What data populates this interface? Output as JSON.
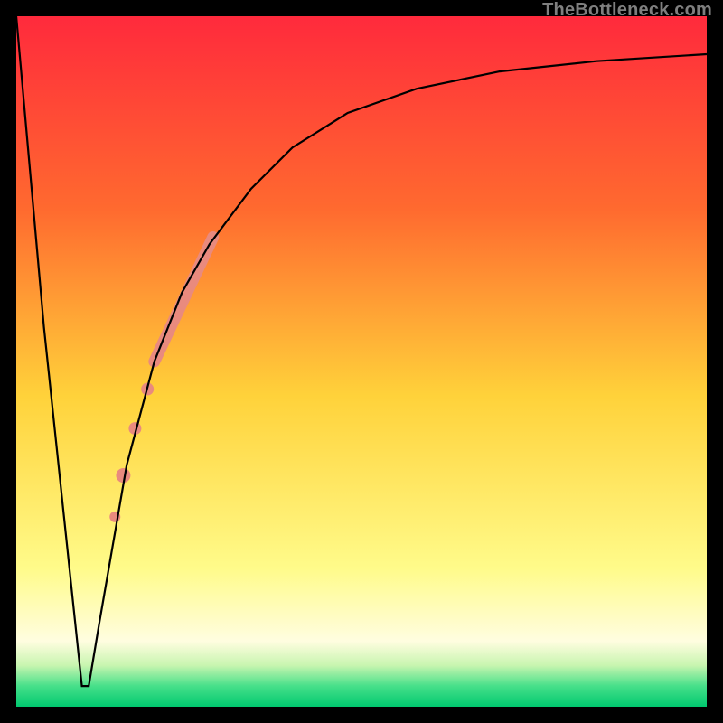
{
  "watermark": "TheBottleneck.com",
  "chart_data": {
    "type": "line",
    "title": "",
    "xlabel": "",
    "ylabel": "",
    "xlim": [
      0,
      100
    ],
    "ylim": [
      0,
      100
    ],
    "grid": false,
    "legend": false,
    "gradient_stops": [
      {
        "offset": 0.0,
        "color": "#ff2a3c"
      },
      {
        "offset": 0.28,
        "color": "#ff6a2f"
      },
      {
        "offset": 0.55,
        "color": "#ffd23a"
      },
      {
        "offset": 0.8,
        "color": "#fffb8a"
      },
      {
        "offset": 0.905,
        "color": "#fffde0"
      },
      {
        "offset": 0.94,
        "color": "#c9f5b0"
      },
      {
        "offset": 0.97,
        "color": "#47e08a"
      },
      {
        "offset": 1.0,
        "color": "#00c86f"
      }
    ],
    "series": [
      {
        "name": "bottleneck-curve",
        "stroke": "#000000",
        "stroke_width": 2.2,
        "x": [
          0,
          4,
          9.5,
          10.5,
          12,
          16,
          20,
          24,
          28,
          34,
          40,
          48,
          58,
          70,
          84,
          100
        ],
        "values": [
          100,
          55,
          3,
          3,
          12,
          35,
          50,
          60,
          67,
          75,
          81,
          86,
          89.5,
          92,
          93.5,
          94.5
        ]
      }
    ],
    "markers": [
      {
        "name": "bold-segment",
        "type": "thick-line",
        "color": "#e98a7e",
        "width": 13,
        "x0": 20,
        "y0": 50,
        "x1": 28.5,
        "y1": 68
      },
      {
        "name": "dot-1",
        "type": "circle",
        "color": "#e98a7e",
        "r": 7,
        "x": 19.0,
        "y": 46
      },
      {
        "name": "dot-2",
        "type": "circle",
        "color": "#e98a7e",
        "r": 7,
        "x": 17.2,
        "y": 40.3
      },
      {
        "name": "dot-3",
        "type": "circle",
        "color": "#e98a7e",
        "r": 8,
        "x": 15.5,
        "y": 33.5
      },
      {
        "name": "dot-4",
        "type": "circle",
        "color": "#e98a7e",
        "r": 6,
        "x": 14.3,
        "y": 27.5
      }
    ]
  }
}
